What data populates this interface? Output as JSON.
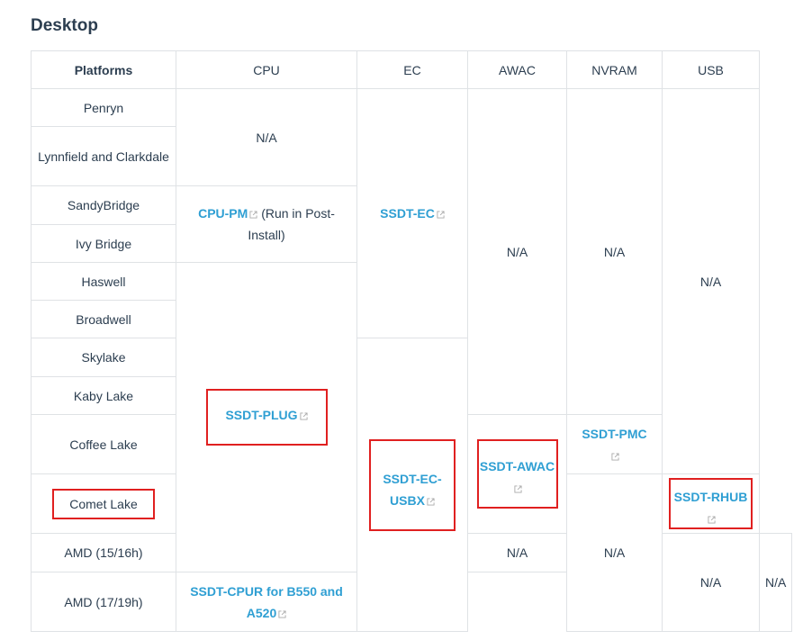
{
  "heading": "Desktop",
  "headers": [
    "Platforms",
    "CPU",
    "EC",
    "AWAC",
    "NVRAM",
    "USB"
  ],
  "platforms": [
    "Penryn",
    "Lynnfield and Clarkdale",
    "SandyBridge",
    "Ivy Bridge",
    "Haswell",
    "Broadwell",
    "Skylake",
    "Kaby Lake",
    "Coffee Lake",
    "Comet Lake",
    "AMD (15/16h)",
    "AMD (17/19h)"
  ],
  "cells": {
    "cpu_na_1": "N/A",
    "cpu_pm_link": "CPU-PM",
    "cpu_pm_note": " (Run in Post-Install)",
    "cpu_plug_link": "SSDT-PLUG",
    "cpu_na_2": "N/A",
    "cpu_cpur_link": "SSDT-CPUR for B550 and A520",
    "ec_link": "SSDT-EC",
    "ec_usbx_link": "SSDT-EC-USBX",
    "awac_na_1": "N/A",
    "awac_link": "SSDT-AWAC",
    "awac_na_2": "N/A",
    "nvram_na_1": "N/A",
    "nvram_pmc_link": "SSDT-PMC",
    "nvram_na_2": "N/A",
    "usb_na_1": "N/A",
    "usb_rhub_link": "SSDT-RHUB",
    "usb_na_2": "N/A"
  },
  "colors": {
    "link": "#2f9fd3",
    "highlight": "#e02020",
    "border": "#dfe2e5"
  },
  "icons": {
    "external_link": "external-link-icon"
  }
}
